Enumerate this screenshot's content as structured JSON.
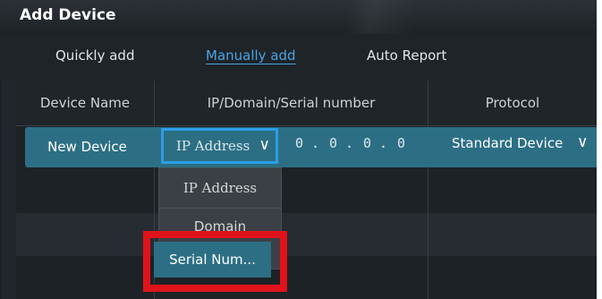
{
  "window": {
    "title": "Add Device"
  },
  "tabs": [
    {
      "label": "Quickly add",
      "active": false
    },
    {
      "label": "Manually add",
      "active": true
    },
    {
      "label": "Auto Report",
      "active": false
    }
  ],
  "table": {
    "columns": [
      "Device Name",
      "IP/Domain/Serial number",
      "Protocol"
    ],
    "rows": [
      {
        "device_name": "New Device",
        "address_type": "IP Address",
        "ip": [
          "0",
          "0",
          "0",
          "0"
        ],
        "protocol": "Standard Device"
      }
    ]
  },
  "address_dropdown": {
    "options": [
      "IP Address",
      "Domain",
      "Serial Num..."
    ],
    "highlighted": "Serial Num..."
  },
  "colors": {
    "accent": "#4aa3e6",
    "selected_row": "#2c6f84",
    "focus_border": "#2a9ee8",
    "highlight_box": "#e0131b"
  }
}
